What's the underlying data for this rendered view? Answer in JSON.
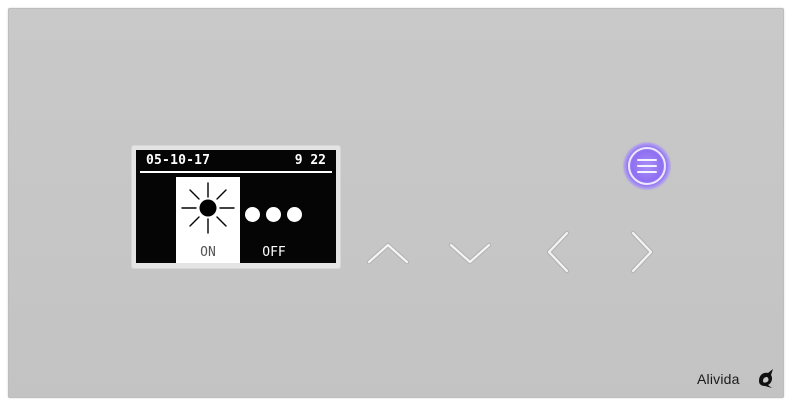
{
  "display": {
    "date": "05-10-17",
    "time": "9 22",
    "options": [
      {
        "label": "ON",
        "icon": "sun-icon",
        "selected": true
      },
      {
        "label": "OFF",
        "icon": "three-dots-icon",
        "selected": false
      }
    ]
  },
  "controls": {
    "menu": {
      "icon": "menu-icon",
      "glow_color": "#8f6ff2"
    },
    "up": {
      "icon": "chevron-up-icon"
    },
    "down": {
      "icon": "chevron-down-icon"
    },
    "left": {
      "icon": "chevron-left-icon"
    },
    "right": {
      "icon": "chevron-right-icon"
    }
  },
  "brand": {
    "name": "Alivida"
  },
  "colors": {
    "panel": "#c6c6c6",
    "screen": "#050505",
    "selected_option": "#ffffff",
    "touch_icon": "#f2f2f2"
  }
}
